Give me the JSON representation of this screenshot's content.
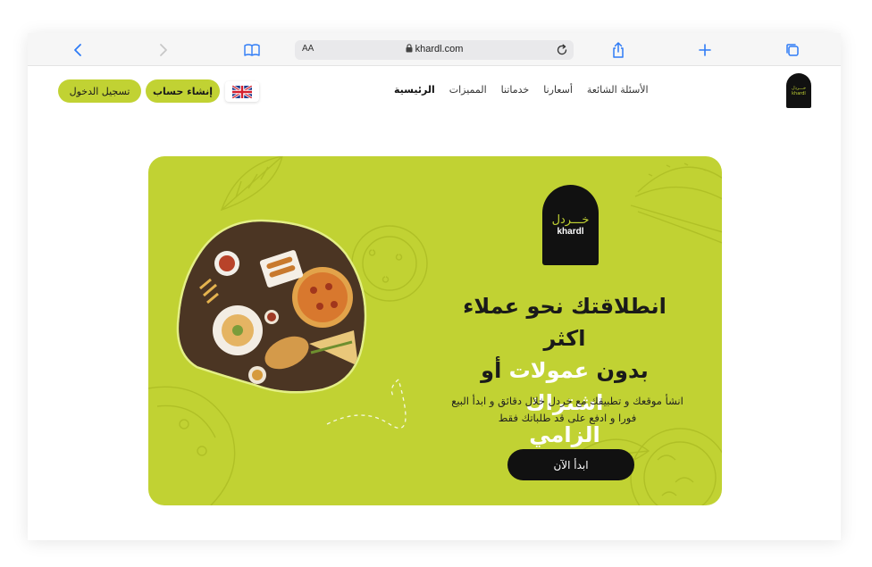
{
  "browser": {
    "reader_label": "AA",
    "url": "khardl.com",
    "icons": [
      "back-icon",
      "forward-icon",
      "bookmarks-icon",
      "lock-icon",
      "reload-icon",
      "share-icon",
      "new-tab-icon",
      "tabs-icon"
    ]
  },
  "nav": {
    "login_label": "تسجيل الدخول",
    "signup_label": "إنشاء حساب",
    "language_flag": "uk-flag-icon",
    "menu": [
      {
        "label": "الرئيسية",
        "active": true
      },
      {
        "label": "المميزات",
        "active": false
      },
      {
        "label": "خدماتنا",
        "active": false
      },
      {
        "label": "أسعارنا",
        "active": false
      },
      {
        "label": "الأسئلة الشائعة",
        "active": false
      }
    ],
    "logo_ar": "خـــردل",
    "logo_en": "khardl"
  },
  "hero": {
    "logo_ar": "خـــردل",
    "logo_en": "khardl",
    "headline_line1": "انطلاقتك نحو عملاء اكثر",
    "headline_part_a": "بدون ",
    "headline_part_b": "عمولات",
    "headline_part_c": " أو ",
    "headline_part_d": "اشتراك",
    "headline_line3": "الزامي",
    "subtext": "انشأ موقعك و تطبيقك مع خردل خلال دقائق و ابدأ البيع فورا و ادفع على قد طلباتك فقط",
    "cta_label": "ابدأ الآن"
  },
  "colors": {
    "brand_green": "#c1d233",
    "dark": "#111111",
    "white": "#ffffff"
  }
}
